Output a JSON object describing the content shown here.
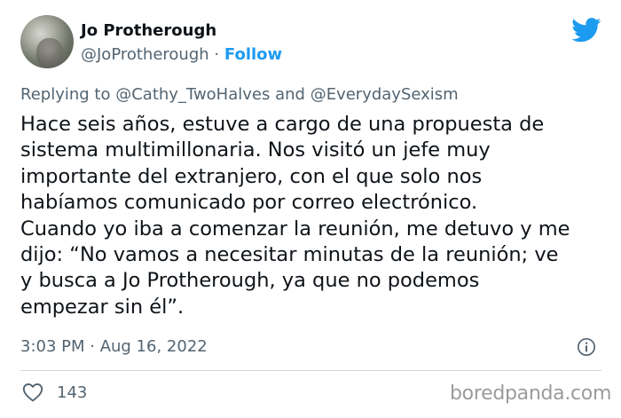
{
  "author": {
    "name": "Jo Protherough",
    "handle": "@JoProtherough",
    "separator": "·",
    "follow_label": "Follow"
  },
  "reply": {
    "prefix": "Replying to",
    "mention1": "@Cathy_TwoHalves",
    "conjunction": "and",
    "mention2": "@EverydaySexism"
  },
  "tweet": {
    "text": "Hace seis años, estuve a cargo de una propuesta de\nsistema multimillonaria. Nos visitó un jefe muy\nimportante del extranjero, con el que solo nos\nhabíamos comunicado por correo electrónico.\nCuando yo iba a comenzar la reunión, me detuvo y me\ndijo: “No vamos a necesitar minutas de la reunión; ve\ny busca a Jo Protherough, ya que no podemos\nempezar sin él”.",
    "timestamp": "3:03 PM · Aug 16, 2022"
  },
  "engagement": {
    "likes": "143"
  },
  "watermark": "boredpanda.com",
  "colors": {
    "accent": "#1d9bf0",
    "text": "#0f1419",
    "muted": "#536471",
    "divider": "#cfd9de",
    "watermark": "#9b9b9b"
  },
  "icons": {
    "bird": "twitter-bird-icon",
    "info": "info-icon",
    "heart": "heart-icon"
  }
}
